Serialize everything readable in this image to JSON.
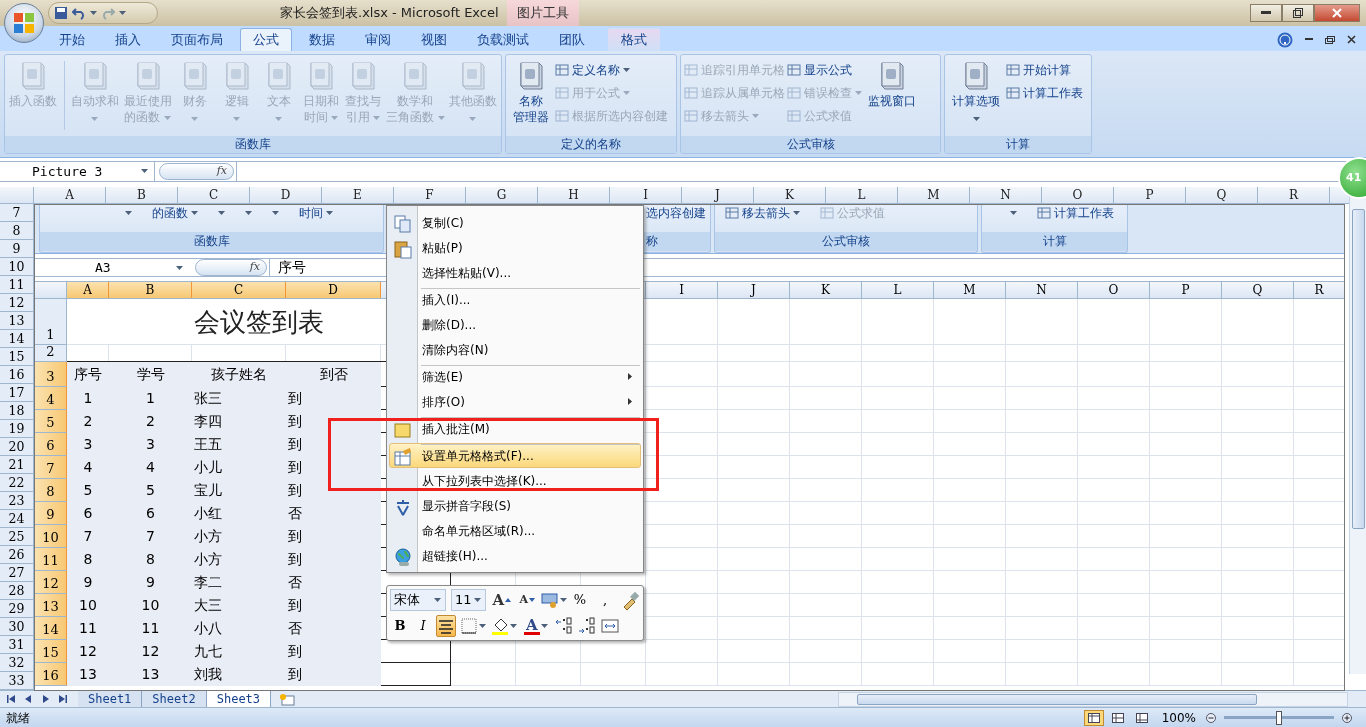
{
  "window": {
    "title": "家长会签到表.xlsx - Microsoft Excel",
    "context_label": "图片工具"
  },
  "ribbon_tabs": [
    {
      "label": "开始",
      "selected": false,
      "kind": "normal"
    },
    {
      "label": "插入",
      "selected": false,
      "kind": "normal"
    },
    {
      "label": "页面布局",
      "selected": false,
      "kind": "normal"
    },
    {
      "label": "公式",
      "selected": true,
      "kind": "normal"
    },
    {
      "label": "数据",
      "selected": false,
      "kind": "normal"
    },
    {
      "label": "审阅",
      "selected": false,
      "kind": "normal"
    },
    {
      "label": "视图",
      "selected": false,
      "kind": "normal"
    },
    {
      "label": "负载测试",
      "selected": false,
      "kind": "normal"
    },
    {
      "label": "团队",
      "selected": false,
      "kind": "normal"
    },
    {
      "label": "格式",
      "selected": false,
      "kind": "contextual"
    }
  ],
  "ribbon_groups": [
    {
      "label": "函数库",
      "items": [
        {
          "kind": "large",
          "lines": [
            "插入函数"
          ],
          "disabled": true,
          "dropdown": false
        },
        {
          "kind": "large",
          "lines": [
            "自动求和"
          ],
          "disabled": true,
          "dropdown": true
        },
        {
          "kind": "large",
          "lines": [
            "最近使用",
            "的函数"
          ],
          "disabled": true,
          "dropdown": true
        },
        {
          "kind": "large",
          "lines": [
            "财务"
          ],
          "disabled": true,
          "dropdown": true
        },
        {
          "kind": "large",
          "lines": [
            "逻辑"
          ],
          "disabled": true,
          "dropdown": true
        },
        {
          "kind": "large",
          "lines": [
            "文本"
          ],
          "disabled": true,
          "dropdown": true
        },
        {
          "kind": "large",
          "lines": [
            "日期和",
            "时间"
          ],
          "disabled": true,
          "dropdown": true
        },
        {
          "kind": "large",
          "lines": [
            "查找与",
            "引用"
          ],
          "disabled": true,
          "dropdown": true
        },
        {
          "kind": "large",
          "lines": [
            "数学和",
            "三角函数"
          ],
          "disabled": true,
          "dropdown": true
        },
        {
          "kind": "large",
          "lines": [
            "其他函数"
          ],
          "disabled": true,
          "dropdown": true
        }
      ]
    },
    {
      "label": "定义的名称",
      "items": [
        {
          "kind": "large",
          "lines": [
            "名称",
            "管理器"
          ],
          "disabled": false,
          "dropdown": false
        },
        {
          "kind": "small",
          "lines": [
            "定义名称"
          ],
          "disabled": false,
          "dropdown": true
        },
        {
          "kind": "small",
          "lines": [
            "用于公式"
          ],
          "disabled": true,
          "dropdown": true
        },
        {
          "kind": "small",
          "lines": [
            "根据所选内容创建"
          ],
          "disabled": true,
          "dropdown": false
        }
      ]
    },
    {
      "label": "公式审核",
      "items": [
        {
          "kind": "small",
          "lines": [
            "追踪引用单元格"
          ],
          "disabled": true,
          "dropdown": false
        },
        {
          "kind": "small",
          "lines": [
            "追踪从属单元格"
          ],
          "disabled": true,
          "dropdown": false
        },
        {
          "kind": "small",
          "lines": [
            "移去箭头"
          ],
          "disabled": true,
          "dropdown": true
        },
        {
          "kind": "small",
          "lines": [
            "显示公式"
          ],
          "disabled": false,
          "dropdown": false
        },
        {
          "kind": "small",
          "lines": [
            "错误检查"
          ],
          "disabled": true,
          "dropdown": true
        },
        {
          "kind": "small",
          "lines": [
            "公式求值"
          ],
          "disabled": true,
          "dropdown": false
        },
        {
          "kind": "large",
          "lines": [
            "监视窗口"
          ],
          "disabled": false,
          "dropdown": false
        }
      ]
    },
    {
      "label": "计算",
      "items": [
        {
          "kind": "large",
          "lines": [
            "计算选项"
          ],
          "disabled": false,
          "dropdown": true
        },
        {
          "kind": "small",
          "lines": [
            "开始计算"
          ],
          "disabled": false,
          "dropdown": false
        },
        {
          "kind": "small",
          "lines": [
            "计算工作表"
          ],
          "disabled": false,
          "dropdown": false
        }
      ]
    }
  ],
  "formula_bar": {
    "name_box": "Picture 3",
    "fx": "fx"
  },
  "columns": [
    "A",
    "B",
    "C",
    "D",
    "E",
    "F",
    "G",
    "H",
    "I",
    "J",
    "K",
    "L",
    "M",
    "N",
    "O",
    "P",
    "Q",
    "R"
  ],
  "row_numbers": [
    "7",
    "8",
    "9",
    "10",
    "11",
    "12",
    "13",
    "14",
    "15",
    "16",
    "17",
    "18",
    "19",
    "20",
    "21",
    "22",
    "23",
    "24",
    "25",
    "26",
    "27",
    "28",
    "29",
    "30",
    "31",
    "32",
    "33"
  ],
  "badge": "41",
  "picture": {
    "ribbon_fragment": [
      {
        "label": "函数库",
        "items": [
          {
            "kind": "caret"
          },
          {
            "kind": "text",
            "label": "的函数",
            "dropdown": true,
            "disabled": false
          },
          {
            "kind": "caret"
          },
          {
            "kind": "caret"
          },
          {
            "kind": "caret"
          },
          {
            "kind": "text",
            "label": "时间",
            "dropdown": true,
            "disabled": false
          }
        ]
      },
      {
        "label": "称",
        "items": [
          {
            "kind": "text",
            "label": "选内容创建",
            "dropdown": false,
            "disabled": false
          }
        ]
      },
      {
        "label": "公式审核",
        "items": [
          {
            "kind": "text",
            "label": "移去箭头",
            "dropdown": true,
            "disabled": false
          },
          {
            "kind": "text",
            "label": "公式求值",
            "dropdown": false,
            "disabled": true
          }
        ]
      },
      {
        "label": "计算",
        "items": [
          {
            "kind": "caret"
          },
          {
            "kind": "text",
            "label": "计算工作表",
            "dropdown": false,
            "disabled": false
          }
        ]
      }
    ],
    "formula_bar": {
      "name_box": "A3",
      "fx": "fx",
      "value": "序号"
    },
    "columns": [
      {
        "label": "A",
        "selected": true
      },
      {
        "label": "B",
        "selected": true
      },
      {
        "label": "C",
        "selected": true
      },
      {
        "label": "D",
        "selected": true
      },
      {
        "label": "I",
        "selected": false
      },
      {
        "label": "J",
        "selected": false
      },
      {
        "label": "K",
        "selected": false
      },
      {
        "label": "L",
        "selected": false
      },
      {
        "label": "M",
        "selected": false
      },
      {
        "label": "N",
        "selected": false
      },
      {
        "label": "O",
        "selected": false
      },
      {
        "label": "P",
        "selected": false
      },
      {
        "label": "Q",
        "selected": false
      },
      {
        "label": "R",
        "selected": false
      }
    ],
    "rows": [
      {
        "number": "1",
        "kind": "title",
        "selected": false,
        "title": "会议签到表"
      },
      {
        "number": "2",
        "kind": "blank",
        "selected": false
      },
      {
        "number": "3",
        "kind": "header",
        "selected": true,
        "cells": [
          "序号",
          "学号",
          "孩子姓名",
          "到否"
        ]
      },
      {
        "number": "4",
        "kind": "data",
        "selected": true,
        "cells": [
          "1",
          "1",
          "张三",
          "到"
        ]
      },
      {
        "number": "5",
        "kind": "data",
        "selected": true,
        "cells": [
          "2",
          "2",
          "李四",
          "到"
        ]
      },
      {
        "number": "6",
        "kind": "data",
        "selected": true,
        "cells": [
          "3",
          "3",
          "王五",
          "到"
        ]
      },
      {
        "number": "7",
        "kind": "data",
        "selected": true,
        "cells": [
          "4",
          "4",
          "小儿",
          "到"
        ]
      },
      {
        "number": "8",
        "kind": "data",
        "selected": true,
        "cells": [
          "5",
          "5",
          "宝儿",
          "到"
        ]
      },
      {
        "number": "9",
        "kind": "data",
        "selected": true,
        "cells": [
          "6",
          "6",
          "小红",
          "否"
        ]
      },
      {
        "number": "10",
        "kind": "data",
        "selected": true,
        "cells": [
          "7",
          "7",
          "小方",
          "到"
        ]
      },
      {
        "number": "11",
        "kind": "data",
        "selected": true,
        "cells": [
          "8",
          "8",
          "小方",
          "到"
        ]
      },
      {
        "number": "12",
        "kind": "data",
        "selected": true,
        "cells": [
          "9",
          "9",
          "李二",
          "否"
        ]
      },
      {
        "number": "13",
        "kind": "data",
        "selected": true,
        "cells": [
          "10",
          "10",
          "大三",
          "到"
        ]
      },
      {
        "number": "14",
        "kind": "data",
        "selected": true,
        "cells": [
          "11",
          "11",
          "小八",
          "否"
        ]
      },
      {
        "number": "15",
        "kind": "data",
        "selected": true,
        "cells": [
          "12",
          "12",
          "九七",
          "到"
        ]
      },
      {
        "number": "16",
        "kind": "data",
        "selected": true,
        "cells": [
          "13",
          "13",
          "刘我",
          "到"
        ]
      }
    ],
    "context_menu": [
      {
        "label": "复制(C)",
        "selected": false,
        "submenu": false,
        "separator_before": false
      },
      {
        "label": "粘贴(P)",
        "selected": false,
        "submenu": false,
        "separator_before": false
      },
      {
        "label": "选择性粘贴(V)...",
        "selected": false,
        "submenu": false,
        "separator_before": false
      },
      {
        "label": "插入(I)...",
        "selected": false,
        "submenu": false,
        "separator_before": true
      },
      {
        "label": "删除(D)...",
        "selected": false,
        "submenu": false,
        "separator_before": false
      },
      {
        "label": "清除内容(N)",
        "selected": false,
        "submenu": false,
        "separator_before": false
      },
      {
        "label": "筛选(E)",
        "selected": false,
        "submenu": true,
        "separator_before": true
      },
      {
        "label": "排序(O)",
        "selected": false,
        "submenu": true,
        "separator_before": false
      },
      {
        "label": "插入批注(M)",
        "selected": false,
        "submenu": false,
        "separator_before": true
      },
      {
        "label": "设置单元格格式(F)...",
        "selected": true,
        "submenu": false,
        "separator_before": true
      },
      {
        "label": "从下拉列表中选择(K)...",
        "selected": false,
        "submenu": false,
        "separator_before": false
      },
      {
        "label": "显示拼音字段(S)",
        "selected": false,
        "submenu": false,
        "separator_before": false
      },
      {
        "label": "命名单元格区域(R)...",
        "selected": false,
        "submenu": false,
        "separator_before": false
      },
      {
        "label": "超链接(H)...",
        "selected": false,
        "submenu": false,
        "separator_before": false
      }
    ],
    "mini_toolbar": {
      "font": "宋体",
      "size": "11",
      "row1": [
        {
          "kind": "grow",
          "label": "A",
          "dropdown": false
        },
        {
          "kind": "shrink",
          "label": "A",
          "dropdown": false
        },
        {
          "kind": "style",
          "dropdown": true
        },
        {
          "kind": "glyph",
          "label": "%"
        },
        {
          "kind": "glyph",
          "label": ","
        },
        {
          "kind": "painter",
          "dropdown": false
        }
      ],
      "row2": [
        {
          "kind": "bold",
          "label": "B",
          "on": false
        },
        {
          "kind": "italic",
          "label": "I",
          "on": false
        },
        {
          "kind": "align",
          "on": true
        },
        {
          "kind": "border",
          "dropdown": true
        },
        {
          "kind": "fill",
          "dropdown": true
        },
        {
          "kind": "fontcolor",
          "label": "A",
          "dropdown": true
        },
        {
          "kind": "incdec",
          "dropdown": false
        },
        {
          "kind": "decdec",
          "dropdown": false
        },
        {
          "kind": "merge",
          "dropdown": false
        }
      ]
    }
  },
  "sheet_tabs": [
    {
      "label": "Sheet1",
      "selected": false
    },
    {
      "label": "Sheet2",
      "selected": false
    },
    {
      "label": "Sheet3",
      "selected": true
    }
  ],
  "status_bar": {
    "text": "就绪",
    "views": [
      {
        "selected": true
      },
      {
        "selected": false
      },
      {
        "selected": false
      }
    ],
    "zoom": "100%",
    "zoom_slider": {
      "level": 0.5
    }
  }
}
